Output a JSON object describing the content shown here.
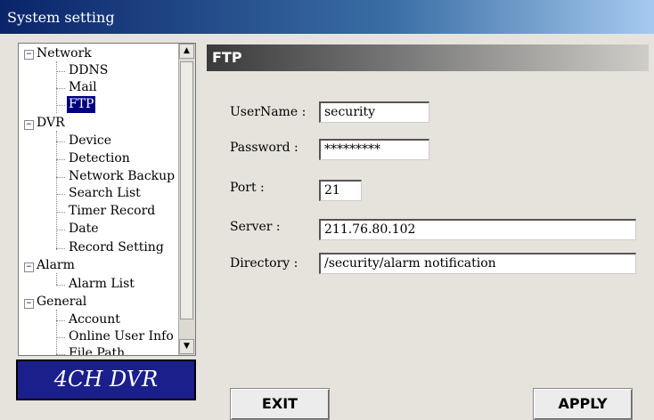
{
  "window": {
    "title": "System setting"
  },
  "tree": {
    "network": "Network",
    "ddns": "DDNS",
    "mail": "Mail",
    "ftp": "FTP",
    "dvr": "DVR",
    "device": "Device",
    "detection": "Detection",
    "network_backup": "Network Backup",
    "search_list": "Search List",
    "timer_record": "Timer Record",
    "date": "Date",
    "record_setting": "Record Setting",
    "alarm": "Alarm",
    "alarm_list": "Alarm List",
    "general": "General",
    "account": "Account",
    "online_user_info": "Online User Info",
    "file_path": "File Path",
    "expander_symbol": "−"
  },
  "brand": "4CH DVR",
  "panel": {
    "title": "FTP"
  },
  "form": {
    "username_label": "UserName :",
    "username_value": "security",
    "password_label": "Password :",
    "password_value": "*********",
    "port_label": "Port :",
    "port_value": "21",
    "server_label": "Server :",
    "server_value": "211.76.80.102",
    "directory_label": "Directory :",
    "directory_value": "/security/alarm notification"
  },
  "buttons": {
    "exit": "EXIT",
    "apply": "APPLY"
  },
  "colors": {
    "selection": "#000080",
    "brand_bg": "#1a1f8c",
    "titlebar": "#0a246a"
  }
}
